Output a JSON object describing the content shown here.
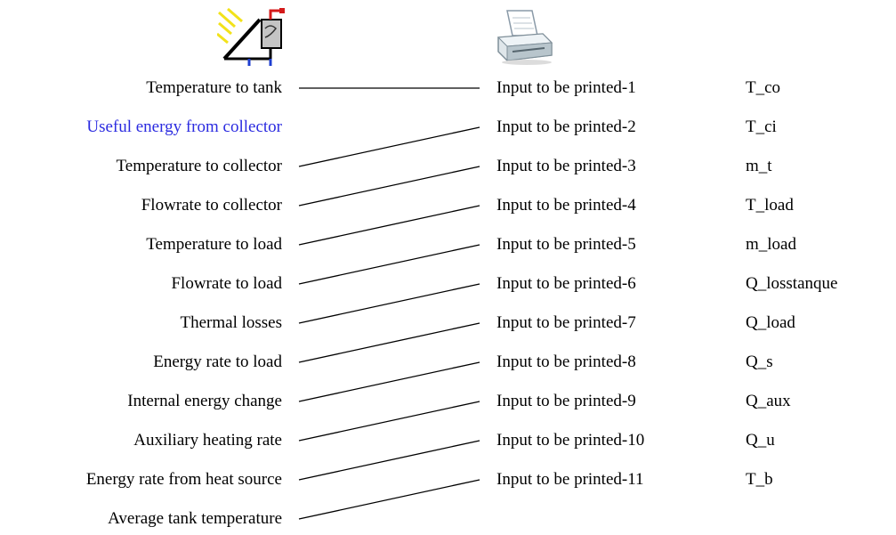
{
  "source_component": {
    "icon": "solar-collector-icon",
    "outputs": [
      {
        "label": "Temperature to tank",
        "selected": false
      },
      {
        "label": "Useful energy from collector",
        "selected": true
      },
      {
        "label": "Temperature to collector",
        "selected": false
      },
      {
        "label": "Flowrate to collector",
        "selected": false
      },
      {
        "label": "Temperature to load",
        "selected": false
      },
      {
        "label": "Flowrate to load",
        "selected": false
      },
      {
        "label": "Thermal losses",
        "selected": false
      },
      {
        "label": "Energy rate to load",
        "selected": false
      },
      {
        "label": "Internal energy change",
        "selected": false
      },
      {
        "label": "Auxiliary heating rate",
        "selected": false
      },
      {
        "label": "Energy rate from heat source",
        "selected": false
      },
      {
        "label": "Average tank temperature",
        "selected": false
      }
    ]
  },
  "target_component": {
    "icon": "printer-icon",
    "inputs": [
      {
        "label": "Input to be printed-1",
        "variable": "T_co"
      },
      {
        "label": "Input to be printed-2",
        "variable": "T_ci"
      },
      {
        "label": "Input to be printed-3",
        "variable": "m_t"
      },
      {
        "label": "Input to be printed-4",
        "variable": "T_load"
      },
      {
        "label": "Input to be printed-5",
        "variable": "m_load"
      },
      {
        "label": "Input to be printed-6",
        "variable": "Q_losstanque"
      },
      {
        "label": "Input to be printed-7",
        "variable": "Q_load"
      },
      {
        "label": "Input to be printed-8",
        "variable": "Q_s"
      },
      {
        "label": "Input to be printed-9",
        "variable": "Q_aux"
      },
      {
        "label": "Input to be printed-10",
        "variable": "Q_u"
      },
      {
        "label": "Input to be printed-11",
        "variable": "T_b"
      }
    ]
  },
  "connections": [
    {
      "from": 0,
      "to": 0
    },
    {
      "from": 2,
      "to": 1
    },
    {
      "from": 3,
      "to": 2
    },
    {
      "from": 4,
      "to": 3
    },
    {
      "from": 5,
      "to": 4
    },
    {
      "from": 6,
      "to": 5
    },
    {
      "from": 7,
      "to": 6
    },
    {
      "from": 8,
      "to": 7
    },
    {
      "from": 9,
      "to": 8
    },
    {
      "from": 10,
      "to": 9
    },
    {
      "from": 11,
      "to": 10
    }
  ],
  "colors": {
    "selected_text": "#2b2be0",
    "text": "#000000",
    "line": "#000000"
  }
}
